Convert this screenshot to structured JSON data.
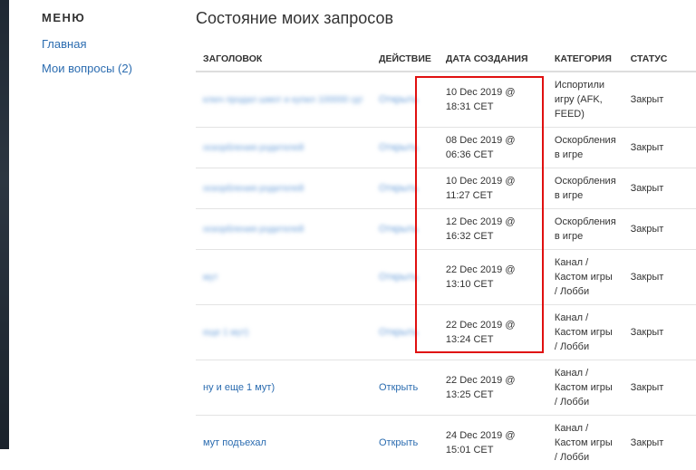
{
  "menu": {
    "title": "МЕНЮ",
    "items": [
      {
        "label": "Главная"
      },
      {
        "label": "Мои вопросы (2)"
      }
    ]
  },
  "page_title": "Состояние моих запросов",
  "table": {
    "headers": {
      "title": "ЗАГОЛОВОК",
      "action": "ДЕЙСТВИЕ",
      "date": "ДАТА СОЗДАНИЯ",
      "category": "КАТЕГОРИЯ",
      "status": "СТАТУС"
    },
    "rows": [
      {
        "title": "ключ продал шмот и купил 100000 гдт",
        "action": "Открыть",
        "date": "10 Dec 2019 @ 18:31 CET",
        "category": "Испортили игру (AFK, FEED)",
        "status": "Закрыт"
      },
      {
        "title": "оскорбления родителей",
        "action": "Открыть",
        "date": "08 Dec 2019 @ 06:36 CET",
        "category": "Оскорбления в игре",
        "status": "Закрыт"
      },
      {
        "title": "оскорбления родителей",
        "action": "Открыть",
        "date": "10 Dec 2019 @ 11:27 CET",
        "category": "Оскорбления в игре",
        "status": "Закрыт"
      },
      {
        "title": "оскорбления родителей",
        "action": "Открыть",
        "date": "12 Dec 2019 @ 16:32 CET",
        "category": "Оскорбления в игре",
        "status": "Закрыт"
      },
      {
        "title": "мут",
        "action": "Открыть",
        "date": "22 Dec 2019 @ 13:10 CET",
        "category": "Канал / Кастом игры / Лобби",
        "status": "Закрыт"
      },
      {
        "title": "еще 1 мут)",
        "action": "Открыть",
        "date": "22 Dec 2019 @ 13:24 CET",
        "category": "Канал / Кастом игры / Лобби",
        "status": "Закрыт"
      },
      {
        "title": "ну и еще 1 мут)",
        "action": "Открыть",
        "date": "22 Dec 2019 @ 13:25 CET",
        "category": "Канал / Кастом игры / Лобби",
        "status": "Закрыт"
      },
      {
        "title": "мут подъехал",
        "action": "Открыть",
        "date": "24 Dec 2019 @ 15:01 CET",
        "category": "Канал / Кастом игры / Лобби",
        "status": "Закрыт"
      }
    ]
  },
  "colors": {
    "link": "#2b6cb0",
    "highlight": "#e01010"
  }
}
